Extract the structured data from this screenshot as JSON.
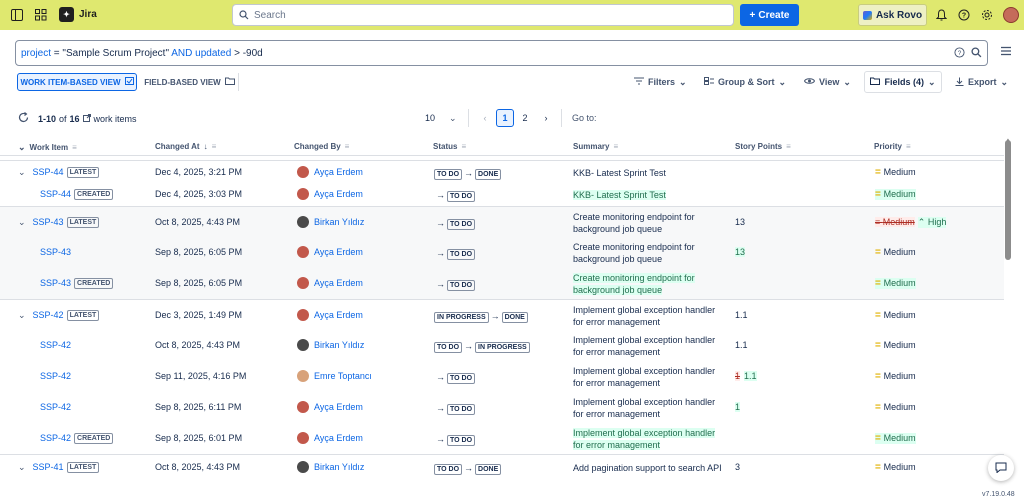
{
  "topbar": {
    "app_name": "Jira",
    "search_placeholder": "Search",
    "create_label": "Create",
    "rovo_label": "Ask Rovo"
  },
  "jql": {
    "field1": "project",
    "op1": "=",
    "value1": "\"Sample Scrum Project\"",
    "and": "AND",
    "field2": "updated",
    "op2": ">",
    "value2": "-90d"
  },
  "views": {
    "work_item_view": "WORK ITEM-BASED VIEW",
    "field_view": "FIELD-BASED VIEW"
  },
  "toolbar": {
    "filters": "Filters",
    "group_sort": "Group & Sort",
    "view": "View",
    "fields": "Fields (4)",
    "export": "Export"
  },
  "pagination": {
    "range": "1-10",
    "of": "of",
    "total": "16",
    "items_label": "work items",
    "page_size": "10",
    "pages": [
      "1",
      "2"
    ],
    "goto_label": "Go to:"
  },
  "columns": {
    "work_item": "Work Item",
    "changed_at": "Changed At",
    "changed_by": "Changed By",
    "status": "Status",
    "summary": "Summary",
    "story_points": "Story Points",
    "priority": "Priority"
  },
  "rows": [
    {
      "key": "SSP-44",
      "badge": "LATEST",
      "changed_at": "Dec 4, 2025, 3:21 PM",
      "user": "Ayça Erdem",
      "status_from": "TO DO",
      "status_to": "DONE",
      "summary1": "KKB- Latest Sprint Test",
      "summary2": "",
      "points": "",
      "priority": "Medium"
    },
    {
      "key": "SSP-44",
      "badge": "CREATED",
      "changed_at": "Dec 4, 2025, 3:03 PM",
      "user": "Ayça Erdem",
      "status_from": "",
      "status_to": "TO DO",
      "summary1": "KKB- Latest Sprint Test",
      "summary2": "",
      "points": "",
      "priority": "Medium"
    },
    {
      "key": "SSP-43",
      "badge": "LATEST",
      "changed_at": "Oct 8, 2025, 4:43 PM",
      "user": "Birkan Yıldız",
      "status_from": "",
      "status_to": "TO DO",
      "summary1": "Create monitoring endpoint for",
      "summary2": "background job queue",
      "points": "13",
      "priority_old": "Medium",
      "priority": "High"
    },
    {
      "key": "SSP-43",
      "badge": "",
      "changed_at": "Sep 8, 2025, 6:05 PM",
      "user": "Ayça Erdem",
      "status_from": "",
      "status_to": "TO DO",
      "summary1": "Create monitoring endpoint for",
      "summary2": "background job queue",
      "points": "13",
      "priority": "Medium"
    },
    {
      "key": "SSP-43",
      "badge": "CREATED",
      "changed_at": "Sep 8, 2025, 6:05 PM",
      "user": "Ayça Erdem",
      "status_from": "",
      "status_to": "TO DO",
      "summary1": "Create monitoring endpoint for",
      "summary2": "background job queue",
      "points": "",
      "priority": "Medium"
    },
    {
      "key": "SSP-42",
      "badge": "LATEST",
      "changed_at": "Dec 3, 2025, 1:49 PM",
      "user": "Ayça Erdem",
      "status_from": "IN PROGRESS",
      "status_to": "DONE",
      "summary1": "Implement global exception handler",
      "summary2": "for error management",
      "points": "1.1",
      "priority": "Medium"
    },
    {
      "key": "SSP-42",
      "badge": "",
      "changed_at": "Oct 8, 2025, 4:43 PM",
      "user": "Birkan Yıldız",
      "status_from": "TO DO",
      "status_to": "IN PROGRESS",
      "summary1": "Implement global exception handler",
      "summary2": "for error management",
      "points": "1.1",
      "priority": "Medium"
    },
    {
      "key": "SSP-42",
      "badge": "",
      "changed_at": "Sep 11, 2025, 4:16 PM",
      "user": "Emre Toptancı",
      "status_from": "",
      "status_to": "TO DO",
      "summary1": "Implement global exception handler",
      "summary2": "for error management",
      "points_old": "1",
      "points": "1.1",
      "priority": "Medium"
    },
    {
      "key": "SSP-42",
      "badge": "",
      "changed_at": "Sep 8, 2025, 6:11 PM",
      "user": "Ayça Erdem",
      "status_from": "",
      "status_to": "TO DO",
      "summary1": "Implement global exception handler",
      "summary2": "for error management",
      "points": "1",
      "priority": "Medium"
    },
    {
      "key": "SSP-42",
      "badge": "CREATED",
      "changed_at": "Sep 8, 2025, 6:01 PM",
      "user": "Ayça Erdem",
      "status_from": "",
      "status_to": "TO DO",
      "summary1": "Implement global exception handler",
      "summary2": "for error management",
      "points": "",
      "priority": "Medium"
    },
    {
      "key": "SSP-41",
      "badge": "LATEST",
      "changed_at": "Oct 8, 2025, 4:43 PM",
      "user": "Birkan Yıldız",
      "status_from": "TO DO",
      "status_to": "DONE",
      "summary1": "Add pagination support to search API",
      "summary2": "",
      "points": "3",
      "priority": "Medium"
    }
  ],
  "footer": {
    "version": "v7.19.0.48"
  }
}
